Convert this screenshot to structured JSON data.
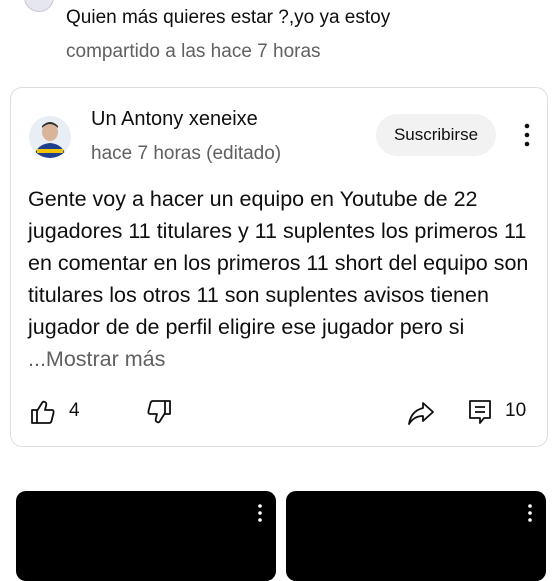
{
  "previous_comment": {
    "text": "Quien más quieres estar ?,yo ya estoy",
    "time": "compartido a las hace 7 horas"
  },
  "post": {
    "author": "Un Antony xeneixe",
    "meta": "hace 7 horas (editado)",
    "subscribe_label": "Suscribirse",
    "body": "Gente voy a hacer un equipo en Youtube de 22 jugadores 11 titulares y 11 suplentes los primeros 11 en comentar en los primeros 11 short del equipo son titulares los otros  11 son suplentes avisos tienen jugador de de perfil eligire ese jugador pero si ",
    "more_label": "...Mostrar más",
    "like_count": "4",
    "reply_count": "10"
  },
  "icons": {
    "like": "thumb-up-icon",
    "dislike": "thumb-down-icon",
    "share": "share-icon",
    "reply": "comment-icon",
    "menu": "more-vert-icon"
  },
  "colors": {
    "subscribe_bg": "#f2f2f2",
    "secondary_text": "#606060",
    "thumbnail_bg": "#000000"
  }
}
